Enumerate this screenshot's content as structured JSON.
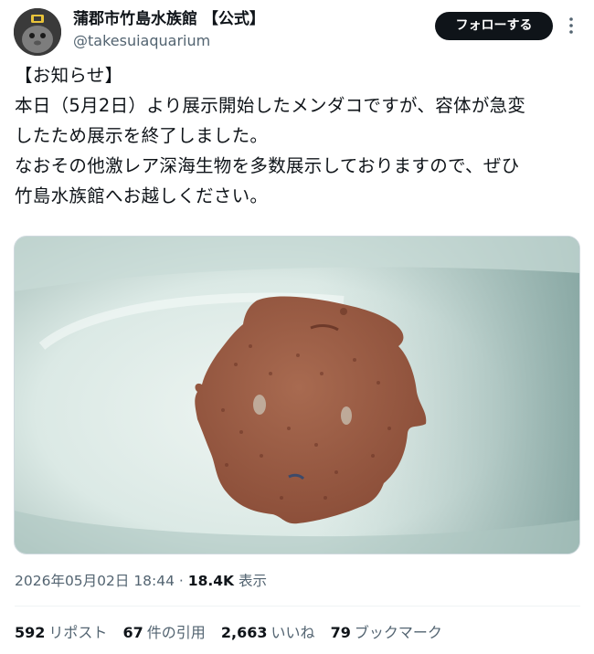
{
  "account": {
    "display_name": "蒲郡市竹島水族館 【公式】",
    "handle": "@takesuiaquarium"
  },
  "header": {
    "follow_label": "フォローする",
    "more_icon": "more-vertical-icon"
  },
  "tweet": {
    "lines": [
      "【お知らせ】",
      "本日（5月2日）より展示開始したメンダコですが、容体が急変",
      "したため展示を終了しました。",
      "なおその他激レア深海生物を多数展示しておりますので、ぜひ",
      "竹島水族館へお越しください。"
    ]
  },
  "meta": {
    "timestamp": "2026年05月02日 18:44",
    "separator": " · ",
    "views_count": "18.4K",
    "views_label": "表示"
  },
  "stats": {
    "reposts": {
      "count": "592",
      "label": "リポスト"
    },
    "quotes": {
      "count": "67",
      "label": "件の引用"
    },
    "likes": {
      "count": "2,663",
      "label": "いいね"
    },
    "bookmarks": {
      "count": "79",
      "label": "ブックマーク"
    }
  },
  "colors": {
    "text": "#0f1419",
    "secondary": "#536471",
    "follow_bg": "#0f1419",
    "divider": "#eff3f4",
    "octopus": "#9a5a43"
  }
}
